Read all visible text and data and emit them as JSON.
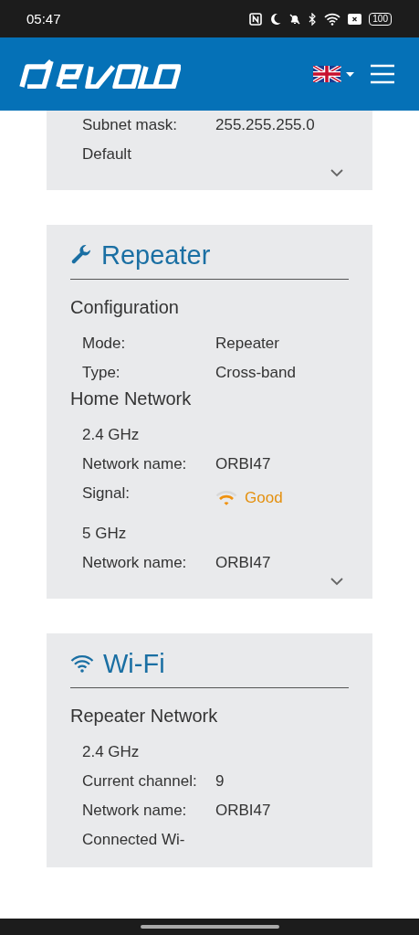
{
  "status_bar": {
    "time": "05:47",
    "battery": "100"
  },
  "header": {
    "language_menu": {
      "expanded": false
    }
  },
  "cards": [
    {
      "groups": [
        {
          "rows": [
            {
              "kind": "row",
              "label": "Subnet mask:",
              "value": "255.255.255.0"
            },
            {
              "kind": "row",
              "label": "Default"
            }
          ]
        }
      ]
    },
    {
      "title": "Repeater",
      "groups": [
        {
          "heading": "Configuration",
          "rows": [
            {
              "kind": "row",
              "label": "Mode:",
              "value": "Repeater"
            },
            {
              "kind": "row",
              "label": "Type:",
              "value": "Cross-band"
            }
          ]
        },
        {
          "heading": "Home Network",
          "rows": [
            {
              "kind": "band",
              "label": "2.4 GHz"
            },
            {
              "kind": "row",
              "label": "Network name:",
              "value": "ORBI47"
            },
            {
              "kind": "signal",
              "label": "Signal:",
              "value": "Good"
            },
            {
              "kind": "band",
              "label": "5 GHz"
            },
            {
              "kind": "row",
              "label": "Network name:",
              "value": "ORBI47"
            }
          ]
        }
      ]
    },
    {
      "title": "Wi-Fi",
      "groups": [
        {
          "heading": "Repeater Network",
          "rows": [
            {
              "kind": "band",
              "label": "2.4 GHz"
            },
            {
              "kind": "row",
              "label": "Current channel:",
              "value": "9"
            },
            {
              "kind": "row",
              "label": "Network name:",
              "value": "ORBI47"
            },
            {
              "kind": "row",
              "label": "Connected Wi-"
            }
          ]
        }
      ]
    }
  ]
}
